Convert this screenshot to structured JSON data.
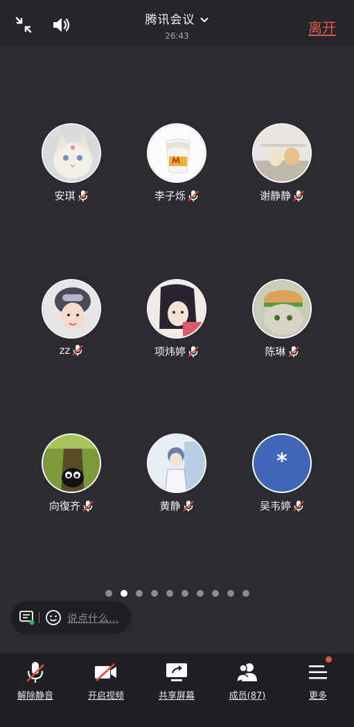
{
  "header": {
    "title": "腾讯会议",
    "timer": "26:43",
    "leave_label": "离开"
  },
  "members": [
    {
      "name": "安琪",
      "muted": true,
      "avatar": "cat-photo"
    },
    {
      "name": "李子烁",
      "muted": true,
      "avatar": "mcdonalds-cup"
    },
    {
      "name": "谢静静",
      "muted": true,
      "avatar": "plush-toys"
    },
    {
      "name": "zz",
      "muted": true,
      "avatar": "girl-helmet"
    },
    {
      "name": "项炜婷",
      "muted": true,
      "avatar": "anime-girl"
    },
    {
      "name": "陈琳",
      "muted": true,
      "avatar": "cat-burger"
    },
    {
      "name": "向復齐",
      "muted": true,
      "avatar": "cartoon-tree"
    },
    {
      "name": "黄静",
      "muted": true,
      "avatar": "anime-boy"
    },
    {
      "name": "吴韦婷",
      "muted": true,
      "avatar": "asterisk",
      "avatar_text": "*"
    }
  ],
  "pagination": {
    "total": 10,
    "current": 2
  },
  "chat": {
    "placeholder": "说点什么..."
  },
  "toolbar": [
    {
      "label": "解除静音",
      "icon": "mic-off-icon"
    },
    {
      "label": "开启视频",
      "icon": "video-off-icon"
    },
    {
      "label": "共享屏幕",
      "icon": "share-screen-icon"
    },
    {
      "label": "成员(87)",
      "icon": "members-icon"
    },
    {
      "label": "更多",
      "icon": "menu-icon"
    }
  ],
  "colors": {
    "accent_red": "#e25a4d",
    "asterisk_avatar": "#4066b8"
  }
}
